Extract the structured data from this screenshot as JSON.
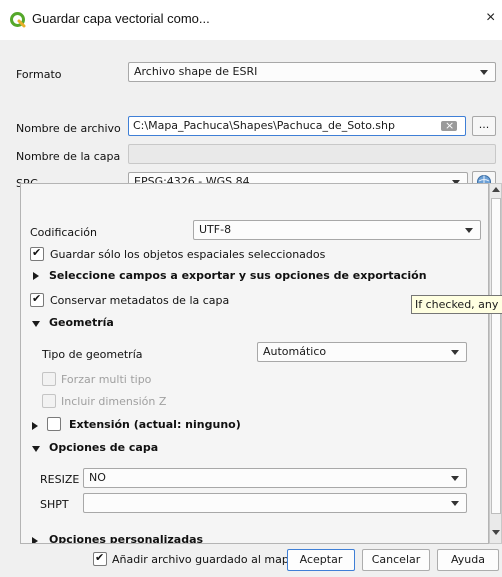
{
  "window": {
    "title": "Guardar capa vectorial como...",
    "close_glyph": "×",
    "icon": "qgis-logo-icon"
  },
  "form": {
    "format_label": "Formato",
    "format_value": "Archivo shape de ESRI",
    "filename_label": "Nombre de archivo",
    "filename_value": "C:\\Mapa_Pachuca\\Shapes\\Pachuca_de_Soto.shp",
    "browse_label": "...",
    "layername_label": "Nombre de la capa",
    "layername_value": "",
    "crs_label": "SRC",
    "crs_value": "EPSG:4326 - WGS 84",
    "crs_icon": "crs-selector-icon"
  },
  "options": {
    "encoding_label": "Codificación",
    "encoding_value": "UTF-8",
    "save_selected_label": "Guardar sólo los objetos espaciales seleccionados",
    "save_selected_checked": true,
    "select_fields_label": "Seleccione campos a exportar y sus opciones de exportación",
    "keep_metadata_label": "Conservar metadatos de la capa",
    "keep_metadata_checked": true,
    "geometry_section": "Geometría",
    "geometry_type_label": "Tipo de geometría",
    "geometry_type_value": "Automático",
    "force_multi_label": "Forzar multi tipo",
    "include_z_label": "Incluir dimensión Z",
    "extent_label": "Extensión (actual: ninguno)",
    "layer_options_section": "Opciones de capa",
    "resize_label": "RESIZE",
    "resize_value": "NO",
    "shpt_label": "SHPT",
    "shpt_value": "",
    "custom_options_section": "Opciones personalizadas"
  },
  "tooltip": {
    "text": "If checked, any m"
  },
  "footer": {
    "add_to_map_label": "Añadir archivo guardado al mapa",
    "add_to_map_checked": true,
    "accept_label": "Aceptar",
    "cancel_label": "Cancelar",
    "help_label": "Ayuda"
  },
  "colors": {
    "accent_border": "#3f7fd6",
    "qgis_green": "#55a82b",
    "tooltip_bg": "#ffffe1"
  }
}
